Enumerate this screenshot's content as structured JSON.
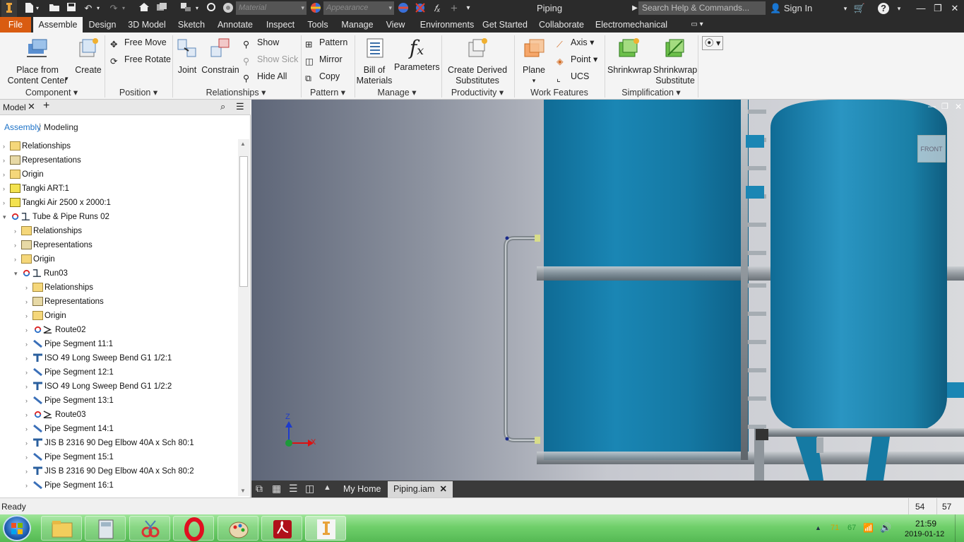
{
  "titlebar": {
    "app_name": "Piping",
    "material_placeholder": "Material",
    "appearance_placeholder": "Appearance",
    "search_placeholder": "Search Help & Commands...",
    "sign_in": "Sign In"
  },
  "tabs": [
    "File",
    "Assemble",
    "Design",
    "3D Model",
    "Sketch",
    "Annotate",
    "Inspect",
    "Tools",
    "Manage",
    "View",
    "Environments",
    "Get Started",
    "Collaborate",
    "Electromechanical"
  ],
  "ribbon": {
    "component": {
      "label": "Component",
      "place_line1": "Place from",
      "place_line2": "Content Center",
      "create": "Create"
    },
    "position": {
      "label": "Position",
      "free_move": "Free Move",
      "free_rotate": "Free Rotate"
    },
    "relationships": {
      "label": "Relationships",
      "joint": "Joint",
      "constrain": "Constrain",
      "show": "Show",
      "show_sick": "Show Sick",
      "hide_all": "Hide All"
    },
    "pattern": {
      "label": "Pattern",
      "pattern": "Pattern",
      "mirror": "Mirror",
      "copy": "Copy"
    },
    "manage": {
      "label": "Manage",
      "bom_line1": "Bill of",
      "bom_line2": "Materials",
      "parameters": "Parameters"
    },
    "productivity": {
      "label": "Productivity",
      "derived_line1": "Create Derived",
      "derived_line2": "Substitutes"
    },
    "work_features": {
      "label": "Work Features",
      "plane": "Plane",
      "axis": "Axis",
      "point": "Point",
      "ucs": "UCS"
    },
    "simplification": {
      "label": "Simplification",
      "shrinkwrap": "Shrinkwrap",
      "shrinkwrap_sub_line1": "Shrinkwrap",
      "shrinkwrap_sub_line2": "Substitute"
    }
  },
  "browser": {
    "tab_label": "Model",
    "view_assembly": "Assembly",
    "view_modeling": "Modeling",
    "tree": [
      {
        "label": "Relationships",
        "level": 0,
        "icon": "folder"
      },
      {
        "label": "Representations",
        "level": 0,
        "icon": "rep"
      },
      {
        "label": "Origin",
        "level": 0,
        "icon": "folder"
      },
      {
        "label": "Tangki ART:1",
        "level": 0,
        "icon": "part"
      },
      {
        "label": "Tangki Air 2500 x 2000:1",
        "level": 0,
        "icon": "part"
      },
      {
        "label": "Tube & Pipe Runs 02",
        "level": 0,
        "icon": "run",
        "expanded": true
      },
      {
        "label": "Relationships",
        "level": 1,
        "icon": "folder"
      },
      {
        "label": "Representations",
        "level": 1,
        "icon": "rep"
      },
      {
        "label": "Origin",
        "level": 1,
        "icon": "folder"
      },
      {
        "label": "Run03",
        "level": 1,
        "icon": "run",
        "expanded": true
      },
      {
        "label": "Relationships",
        "level": 2,
        "icon": "folder"
      },
      {
        "label": "Representations",
        "level": 2,
        "icon": "rep"
      },
      {
        "label": "Origin",
        "level": 2,
        "icon": "folder"
      },
      {
        "label": "Route02",
        "level": 2,
        "icon": "route"
      },
      {
        "label": "Pipe Segment 11:1",
        "level": 2,
        "icon": "pipe"
      },
      {
        "label": "ISO 49 Long Sweep Bend G1 1/2:1",
        "level": 2,
        "icon": "fitting"
      },
      {
        "label": "Pipe Segment 12:1",
        "level": 2,
        "icon": "pipe"
      },
      {
        "label": "ISO 49 Long Sweep Bend G1 1/2:2",
        "level": 2,
        "icon": "fitting"
      },
      {
        "label": "Pipe Segment 13:1",
        "level": 2,
        "icon": "pipe"
      },
      {
        "label": "Route03",
        "level": 2,
        "icon": "route"
      },
      {
        "label": "Pipe Segment 14:1",
        "level": 2,
        "icon": "pipe"
      },
      {
        "label": "JIS B 2316 90 Deg Elbow 40A x Sch 80:1",
        "level": 2,
        "icon": "fitting"
      },
      {
        "label": "Pipe Segment 15:1",
        "level": 2,
        "icon": "pipe"
      },
      {
        "label": "JIS B 2316 90 Deg Elbow 40A x Sch 80:2",
        "level": 2,
        "icon": "fitting"
      },
      {
        "label": "Pipe Segment 16:1",
        "level": 2,
        "icon": "pipe"
      }
    ]
  },
  "viewport": {
    "viewcube_label": "FRONT",
    "triad_x": "X",
    "triad_z": "Z",
    "colors": {
      "tank": "#1a7fa6",
      "tank_dark": "#0f5d80",
      "pipe": "#9aa0a6"
    }
  },
  "doc_tabs": {
    "home": "My Home",
    "active": "Piping.iam"
  },
  "status": {
    "text": "Ready",
    "count_a": "54",
    "count_b": "57"
  },
  "taskbar": {
    "tray_a": "71",
    "tray_b": "67",
    "time": "21:59",
    "date": "2019-01-12"
  }
}
